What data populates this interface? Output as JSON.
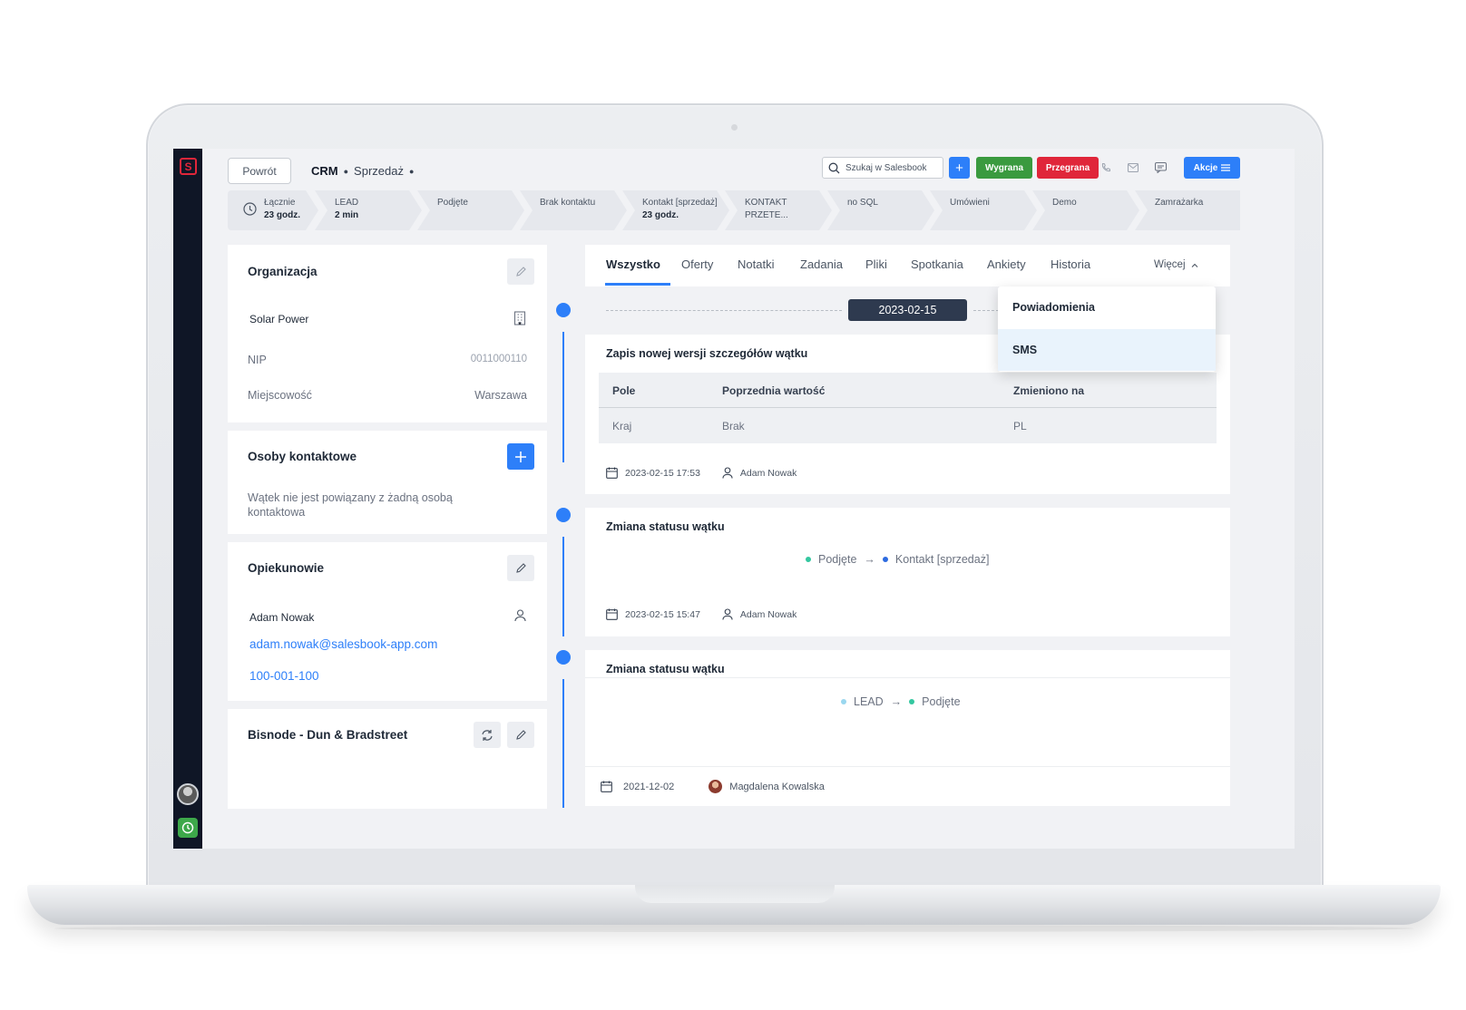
{
  "header": {
    "back_label": "Powrót",
    "breadcrumb": [
      "CRM",
      "Sprzedaż"
    ],
    "search_placeholder": "Szukaj w Salesbook",
    "add_label": "+",
    "won_label": "Wygrana",
    "lost_label": "Przegrana",
    "actions_label": "Akcje"
  },
  "pipeline": {
    "total_label": "Łącznie",
    "total_value": "23 godz.",
    "stages": [
      {
        "name": "LEAD",
        "time": "2 min"
      },
      {
        "name": "Podjęte",
        "time": ""
      },
      {
        "name": "Brak kontaktu",
        "time": ""
      },
      {
        "name": "Kontakt [sprzedaż]",
        "time": "23 godz."
      },
      {
        "name": "KONTAKT PRZETE...",
        "time": ""
      },
      {
        "name": "no SQL",
        "time": ""
      },
      {
        "name": "Umówieni",
        "time": ""
      },
      {
        "name": "Demo",
        "time": ""
      },
      {
        "name": "Zamrażarka",
        "time": ""
      }
    ]
  },
  "organization": {
    "title": "Organizacja",
    "name": "Solar Power",
    "fields": [
      {
        "label": "NIP",
        "value": "0011000110"
      },
      {
        "label": "Miejscowość",
        "value": "Warszawa"
      }
    ]
  },
  "contacts": {
    "title": "Osoby kontaktowe",
    "empty_text": "Wątek nie jest powiązany z żadną osobą kontaktowa"
  },
  "guardians": {
    "title": "Opiekunowie",
    "name": "Adam Nowak",
    "email": "adam.nowak@salesbook-app.com",
    "phone": "100-001-100"
  },
  "bisnode": {
    "title": "Bisnode - Dun & Bradstreet"
  },
  "tabs": {
    "items": [
      "Wszystko",
      "Oferty",
      "Notatki",
      "Zadania",
      "Pliki",
      "Spotkania",
      "Ankiety",
      "Historia"
    ],
    "more_label": "Więcej"
  },
  "dropdown": {
    "items": [
      "Powiadomienia",
      "SMS"
    ]
  },
  "timeline": {
    "date_marker": "2023-02-15",
    "entries": [
      {
        "title": "Zapis nowej wersji szczegółów wątku",
        "table": {
          "headers": [
            "Pole",
            "Poprzednia wartość",
            "Zmieniono na"
          ],
          "row": [
            "Kraj",
            "Brak",
            "PL"
          ]
        },
        "date": "2023-02-15 17:53",
        "user": "Adam Nowak"
      },
      {
        "title": "Zmiana statusu wątku",
        "from": "Podjęte",
        "to": "Kontakt [sprzedaż]",
        "date": "2023-02-15 15:47",
        "user": "Adam Nowak"
      },
      {
        "title": "Zmiana statusu wątku",
        "from": "LEAD",
        "to": "Podjęte",
        "date": "2021-12-02",
        "user": "Magdalena Kowalska"
      }
    ]
  },
  "colors": {
    "accent": "#2d7ff9",
    "won": "#3a9a3f",
    "lost": "#e0263a",
    "sidebar": "#0f1626",
    "status_podjete": "#34c7a0",
    "status_kontakt": "#2d6be0",
    "status_lead": "#9ad7ef"
  }
}
